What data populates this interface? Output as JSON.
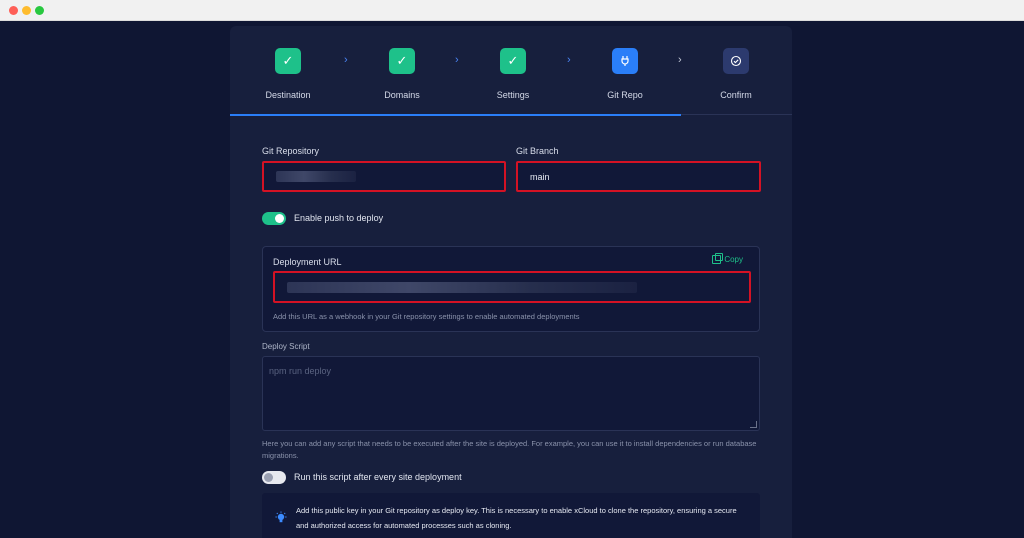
{
  "stepper": {
    "steps": [
      {
        "label": "Destination",
        "state": "done",
        "icon": "check-icon"
      },
      {
        "label": "Domains",
        "state": "done",
        "icon": "check-icon"
      },
      {
        "label": "Settings",
        "state": "done",
        "icon": "check-icon"
      },
      {
        "label": "Git Repo",
        "state": "current",
        "icon": "git-icon"
      },
      {
        "label": "Confirm",
        "state": "todo",
        "icon": "confirm-icon"
      }
    ]
  },
  "form": {
    "git_repository": {
      "label": "Git Repository",
      "value": ""
    },
    "git_branch": {
      "label": "Git Branch",
      "value": "main"
    },
    "push_to_deploy": {
      "label": "Enable push to deploy",
      "enabled": true
    },
    "deployment_url": {
      "label": "Deployment URL",
      "copy_label": "Copy",
      "hint": "Add this URL as a webhook in your Git repository settings to enable automated deployments"
    },
    "deploy_script": {
      "label": "Deploy Script",
      "placeholder": "npm run deploy",
      "hint": "Here you can add any script that needs to be executed after the site is deployed. For example, you can use it to install dependencies or run database migrations."
    },
    "run_script": {
      "label": "Run this script after every site deployment",
      "enabled": false
    },
    "deploy_key_info": "Add this public key in your Git repository as deploy key. This is necessary to enable xCloud to clone the repository, ensuring a secure and authorized access for automated processes such as cloning."
  },
  "colors": {
    "background": "#0f1633",
    "panel": "#171f3d",
    "accent_green": "#1ec18a",
    "accent_blue": "#2a7ef8",
    "highlight_red": "#d41224"
  }
}
